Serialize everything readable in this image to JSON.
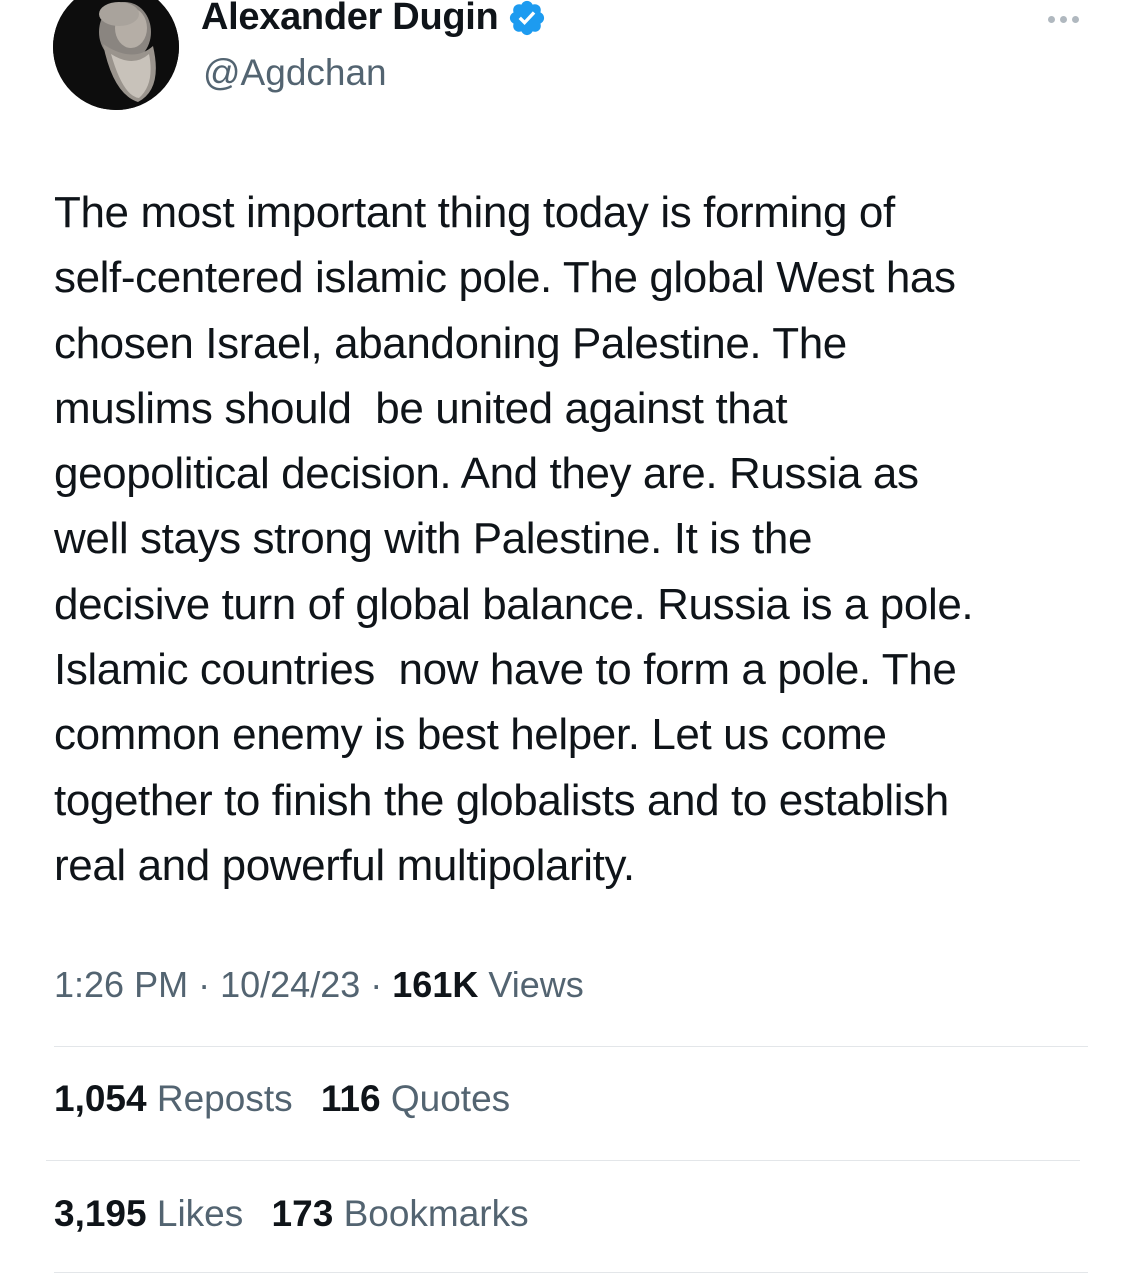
{
  "author": {
    "name": "Alexander Dugin",
    "handle": "@Agdchan",
    "verified_color": "#1d9bf0"
  },
  "tweet": {
    "text": "The most important thing today is forming of\nself-centered islamic pole. The global West has\nchosen Israel, abandoning Palestine. The\nmuslims should  be united against that\ngeopolitical decision. And they are. Russia as\nwell stays strong with Palestine. It is the\ndecisive turn of global balance. Russia is a pole.\nIslamic countries  now have to form a pole. The\ncommon enemy is best helper. Let us come\ntogether to finish the globalists and to establish\nreal and powerful multipolarity."
  },
  "meta": {
    "time": "1:26 PM",
    "date": "10/24/23",
    "views_count": "161K",
    "views_label": "Views",
    "separator": "·"
  },
  "stats": {
    "reposts_count": "1,054",
    "reposts_label": "Reposts",
    "quotes_count": "116",
    "quotes_label": "Quotes",
    "likes_count": "3,195",
    "likes_label": "Likes",
    "bookmarks_count": "173",
    "bookmarks_label": "Bookmarks"
  },
  "icons": {
    "avatar": "avatar-portrait",
    "verified": "verified-badge-icon",
    "more": "more-options-icon"
  }
}
